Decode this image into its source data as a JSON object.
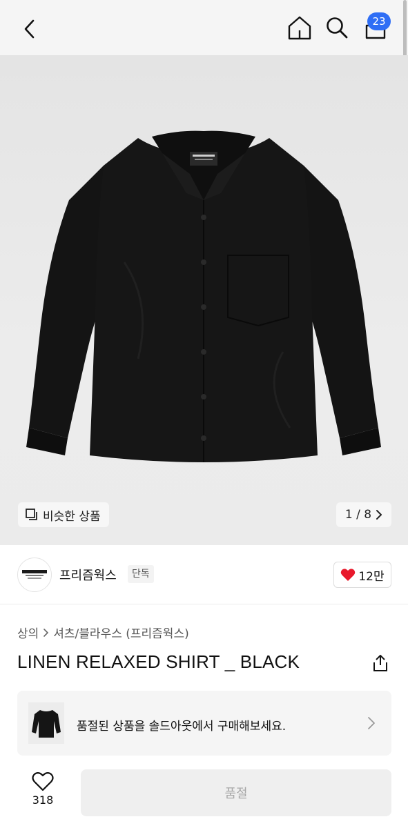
{
  "header": {
    "back_icon": "chevron-left-icon",
    "home_icon": "home-icon",
    "search_icon": "search-icon",
    "cart_icon": "cart-icon",
    "cart_count": "23",
    "accent_color": "#2f6ef5"
  },
  "gallery": {
    "similar_label": "비슷한 상품",
    "page_indicator": "1 / 8"
  },
  "brand": {
    "name": "프리즘웍스",
    "tag": "단독",
    "like_count": "12만"
  },
  "product": {
    "breadcrumb": [
      "상의",
      "셔츠/블라우스 (프리즘웍스)"
    ],
    "title": "LINEN RELAXED SHIRT _ BLACK"
  },
  "soldout": {
    "message": "품절된 상품을 솔드아웃에서 구매해보세요."
  },
  "bottom": {
    "wish_count": "318",
    "buy_label": "품절"
  }
}
